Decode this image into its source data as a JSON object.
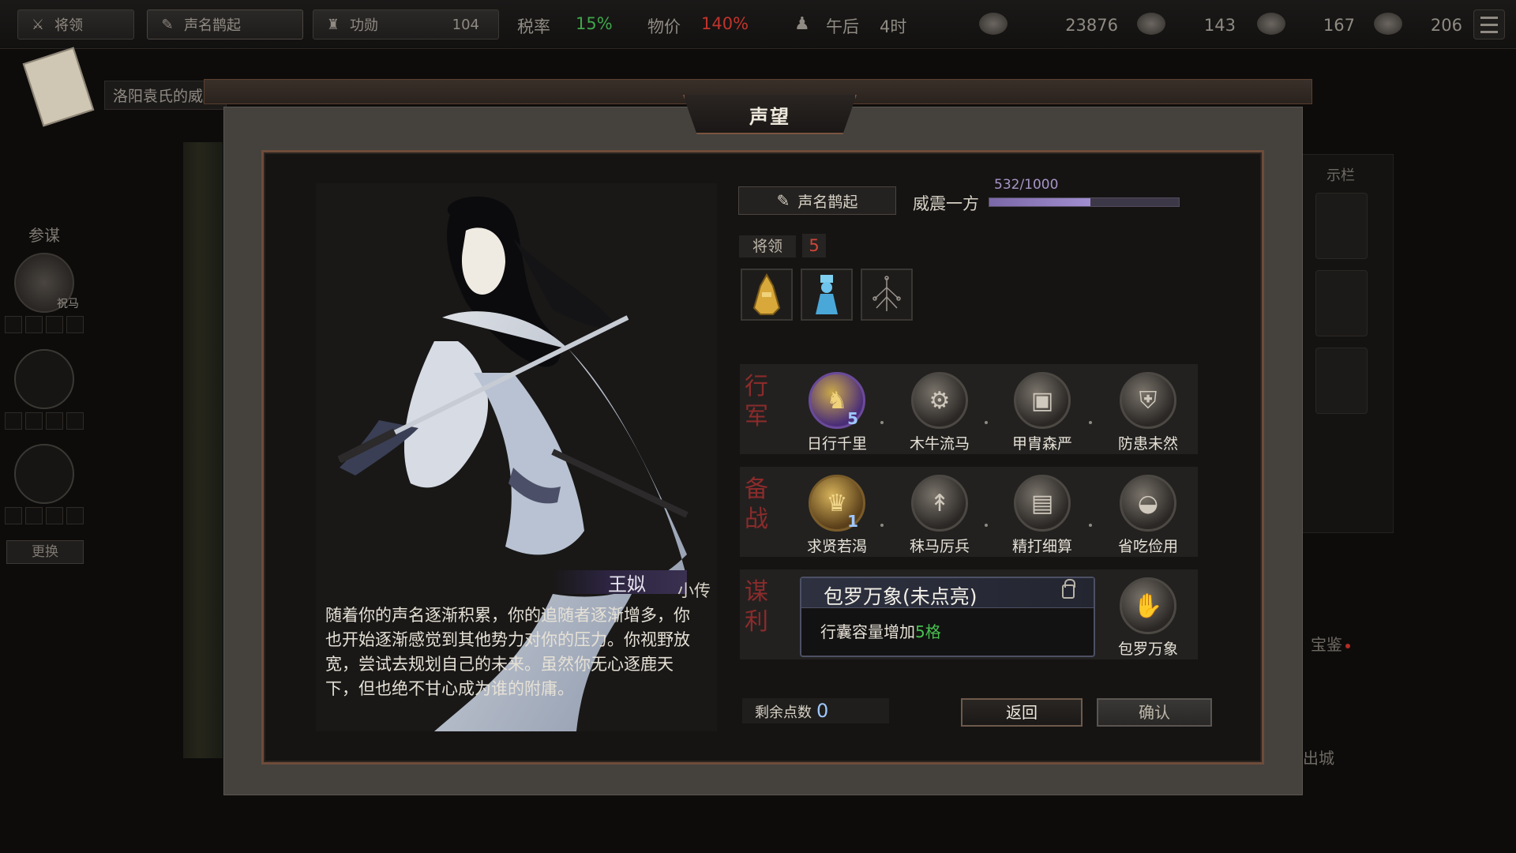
{
  "topbar": {
    "generals_label": "将领",
    "fame_label": "声名鹊起",
    "merit_label": "功勋",
    "merit_value": "104",
    "tax_label": "税率",
    "tax_value": "15%",
    "price_label": "物价",
    "price_value": "140%",
    "time_label": "午后",
    "time_hour": "4时",
    "resources": [
      "23876",
      "143",
      "167",
      "206"
    ]
  },
  "quest": {
    "text": "洛阳袁氏的威胁"
  },
  "left_panel": {
    "advisor_label": "参谋",
    "advisor_name": "祝马",
    "change_button": "更换"
  },
  "right_panel": {
    "title": "示栏",
    "treasure_label": "宝鉴",
    "exit_label": "出城"
  },
  "modal": {
    "title": "声望"
  },
  "character": {
    "name": "王姒",
    "bio_button": "小传",
    "story": "随着你的声名逐渐积累，你的追随者逐渐增多，你也开始逐渐感觉到其他势力对你的压力。你视野放宽，尝试去规划自己的未来。虽然你无心逐鹿天下，但也绝不甘心成为谁的附庸。"
  },
  "rank": {
    "current": "声名鹊起",
    "next": "威震一方",
    "progress_text": "532/1000",
    "progress": 0.532
  },
  "generals": {
    "label": "将领",
    "count": "5",
    "icons": [
      "golden-armor-icon",
      "blue-robe-icon",
      "tree-diagram-icon"
    ]
  },
  "skill_rows": [
    {
      "label": "行军",
      "skills": [
        {
          "name": "日行千里",
          "level": "5",
          "style": "purple",
          "icon": "horse-icon"
        },
        {
          "name": "木牛流马",
          "level": "",
          "style": "grey",
          "icon": "cart-icon"
        },
        {
          "name": "甲胄森严",
          "level": "",
          "style": "grey",
          "icon": "armor-icon"
        },
        {
          "name": "防患未然",
          "level": "",
          "style": "grey",
          "icon": "shield-icon"
        }
      ]
    },
    {
      "label": "备战",
      "skills": [
        {
          "name": "求贤若渴",
          "level": "1",
          "style": "gold",
          "icon": "scholar-icon"
        },
        {
          "name": "秣马厉兵",
          "level": "",
          "style": "grey",
          "icon": "spear-icon"
        },
        {
          "name": "精打细算",
          "level": "",
          "style": "grey",
          "icon": "abacus-icon"
        },
        {
          "name": "省吃俭用",
          "level": "",
          "style": "grey",
          "icon": "bowl-icon"
        }
      ]
    },
    {
      "label": "谋利",
      "skills": [
        {
          "name": "包罗万象",
          "level": "",
          "style": "grey",
          "icon": "bag-icon"
        }
      ]
    }
  ],
  "tooltip": {
    "title": "包罗万象(未点亮)",
    "desc_prefix": "行囊容量增加",
    "desc_highlight": "5格"
  },
  "footer": {
    "points_label": "剩余点数",
    "points_value": "0",
    "back_button": "返回",
    "confirm_button": "确认"
  }
}
